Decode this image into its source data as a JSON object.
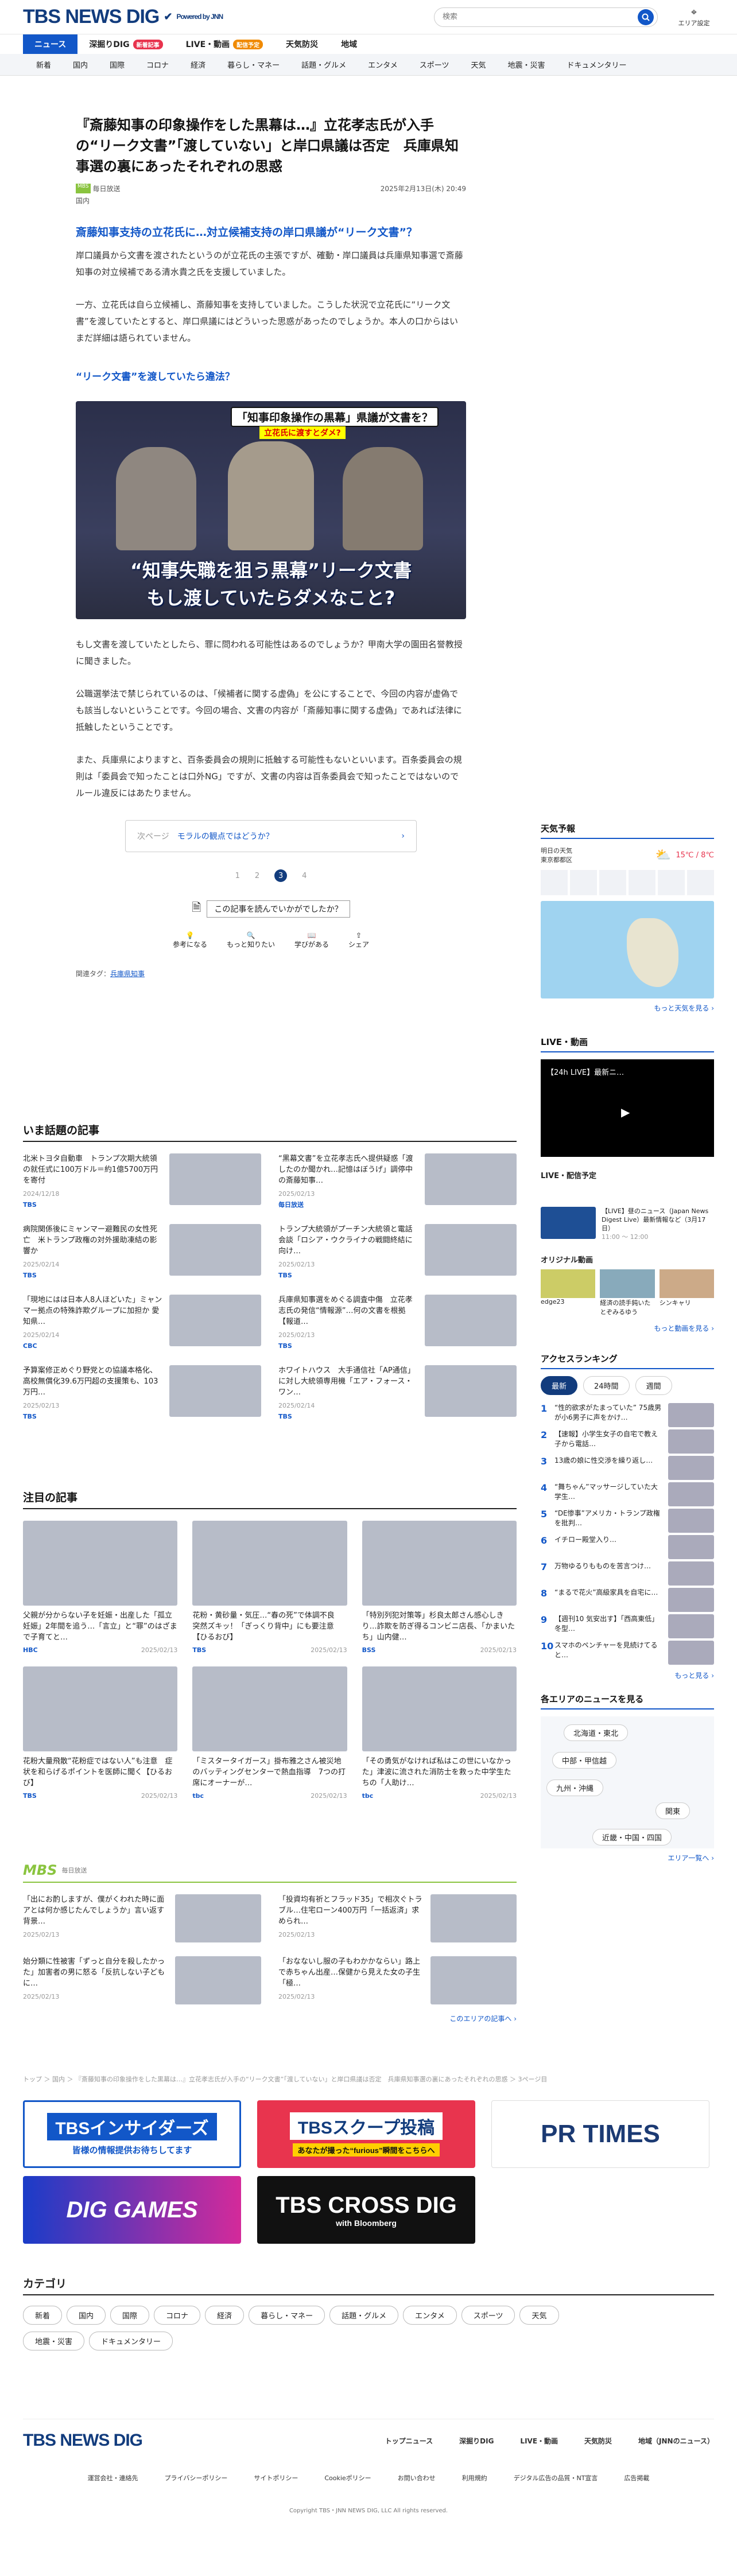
{
  "header": {
    "logo": "TBS NEWS DIG",
    "logo_sub": "Powered by JNN",
    "search_placeholder": "検索",
    "area_label": "エリア設定"
  },
  "gnav": [
    {
      "label": "ニュース",
      "active": true
    },
    {
      "label": "深掘りDIG",
      "badge": "新着記事"
    },
    {
      "label": "LIVE・動画",
      "badge": "配信予定"
    },
    {
      "label": "天気防災"
    },
    {
      "label": "地域"
    }
  ],
  "snav": [
    "新着",
    "国内",
    "国際",
    "コロナ",
    "経済",
    "暮らし・マネー",
    "話題・グルメ",
    "エンタメ",
    "スポーツ",
    "天気",
    "地震・災害",
    "ドキュメンタリー"
  ],
  "article": {
    "title": "『斎藤知事の印象操作をした黒幕は…』立花孝志氏が入手の“リーク文書”「渡していない」と岸口県議は否定　兵庫県知事選の裏にあったそれぞれの思惑",
    "source": "毎日放送",
    "category": "国内",
    "date": "2025年2月13日(木) 20:49",
    "lead": "斎藤知事支持の立花氏に…対立候補支持の岸口県議が“リーク文書”？",
    "p1": "岸口議員から文書を渡されたというのが立花氏の主張ですが、確動・岸口議員は兵庫県知事選で斎藤知事の対立候補である清水貴之氏を支援していました。",
    "p2": "一方、立花氏は自ら立候補し、斎藤知事を支持していました。こうした状況で立花氏に“リーク文書”を渡していたとすると、岸口県議にはどういった思惑があったのでしょうか。本人の口からはいまだ詳細は語られていません。",
    "h2": "リーク文書”を渡していたら違法？",
    "caption_top": "「知事印象操作の黒幕」県議が文書を？",
    "caption_sub": "立花氏に渡すとダメ?",
    "caption_big1": "“知事失職を狙う黒幕”リーク文書",
    "caption_big2": "もし渡していたらダメなこと?",
    "p3": "もし文書を渡していたとしたら、罪に問われる可能性はあるのでしょうか？甲南大学の園田名誉教授に聞きました。",
    "p4": "公職選挙法で禁じられているのは、「候補者に関する虚偽」を公にすることで、今回の内容が虚偽でも該当しないということです。今回の場合、文書の内容が「斎藤知事に関する虚偽」であれば法律に抵触したということです。",
    "p5": "また、兵庫県によりますと、百条委員会の規則に抵触する可能性もないといいます。百条委員会の規則は「委員会で知ったことは口外NG」ですが、文書の内容は百条委員会で知ったことではないのでルール違反にはあたりません。",
    "next_label": "次ページ",
    "next_title": "モラルの観点ではどうか？",
    "pages": [
      "1",
      "2",
      "3",
      "4"
    ],
    "feedback_q": "この記事を読んでいかがでしたか？",
    "reactions": [
      "参考になる",
      "もっと知りたい",
      "学びがある",
      "シェア"
    ],
    "tags_label": "関連タグ：",
    "tag": "兵庫県知事"
  },
  "trending": {
    "title": "いま話題の記事",
    "items": [
      {
        "text": "北米トヨタ自動車　トランプ次期大統領の就任式に100万ドル＝約1億5700万円を寄付",
        "date": "2024/12/18",
        "src": "TBS"
      },
      {
        "text": "“黒幕文書”を立花孝志氏へ提供疑惑「渡したのか聞かれ…記憶はぼうげ」調停中の斎藤知事…",
        "date": "2025/02/13",
        "src": "毎日放送"
      },
      {
        "text": "病院関係後にミャンマー避難民の女性死亡　米トランプ政権の対外援助凍結の影響か",
        "date": "2025/02/14",
        "src": "TBS"
      },
      {
        "text": "トランプ大統領がプーチン大統領と電話会談「ロシア・ウクライナの戦闘終結に向け…",
        "date": "2025/02/13",
        "src": "TBS"
      },
      {
        "text": "「現地にはは日本人8人ほどいた」ミャンマー拠点の特殊詐欺グループに加担か 愛知県…",
        "date": "2025/02/14",
        "src": "CBC"
      },
      {
        "text": "兵庫県知事選をめぐる調査中傷　立花孝志氏の発信“情報源”…何の文書を根拠【報道…",
        "date": "2025/02/13",
        "src": "TBS"
      },
      {
        "text": "予算案修正めぐり野党との協議本格化、高校無償化39.6万円超の支援策も、103万円…",
        "date": "2025/02/13",
        "src": "TBS"
      },
      {
        "text": "ホワイトハウス　大手通信社「AP通信」に対し大統領専用機「エア・フォース・ワン…",
        "date": "2025/02/14",
        "src": "TBS"
      }
    ]
  },
  "featured": {
    "title": "注目の記事",
    "items": [
      {
        "text": "父親が分からない子を妊娠・出産した「孤立妊娠」2年間を追う…「言立」と“罪”のはざまで子育てと…",
        "date": "2025/02/13",
        "src": "HBC"
      },
      {
        "text": "花粉・黄砂量・気圧…“春の死”で体調不良　突然ズキッ！「ぎっくり背中」にも要注意【ひるおび】",
        "date": "2025/02/13",
        "src": "TBS"
      },
      {
        "text": "「特別列犯対策等」杉良太郎さん感心しきり…詐欺を防ぎ得るコンビニ店長、「かまいたち」山内健…",
        "date": "2025/02/13",
        "src": "BSS"
      },
      {
        "text": "花粉大量飛散“花粉症ではない人”も注意　症状を和らげるポイントを医師に聞く【ひるおび】",
        "date": "2025/02/13",
        "src": "TBS"
      },
      {
        "text": "「ミスタータイガース」掛布雅之さん被災地のバッティングセンターで熱血指導　7つの打席にオーナーが…",
        "date": "2025/02/13",
        "src": "tbc"
      },
      {
        "text": "「その勇気がなければ私はこの世にいなかった」津波に流された消防士を救った中学生たちの「人助け…",
        "date": "2025/02/13",
        "src": "tbc"
      }
    ]
  },
  "mbs": {
    "logo": "MBS",
    "label": "毎日放送",
    "items": [
      {
        "text": "「出にお酌しますが、僕がくわれた時に面アとは何か感じたんでしょうか」言い返す背景…",
        "date": "2025/02/13"
      },
      {
        "text": "「投資均有祈とフラッド35」で相次ぐトラブル…住宅ローン400万円「一括返済」求められ…",
        "date": "2025/02/13"
      },
      {
        "text": "始分類に性被害「ずっと自分を殺したかった」加害者の男に怒る「反抗しない子どもに…",
        "date": "2025/02/13"
      },
      {
        "text": "「おなないし服の子もわかかならい」路上で赤ちゃん出産…保健から見えた女の子生「極…",
        "date": "2025/02/13"
      }
    ],
    "more": "このエリアの記事へ"
  },
  "breadcrumb": "トップ ＞ 国内 ＞ 『斎藤知事の印象操作をした黒幕は…』立花孝志氏が入手の“リーク文書”「渡していない」と岸口県議は否定　兵庫県知事選の裏にあったそれぞれの思惑 ＞ 3ページ目",
  "banners": {
    "insider": "TBSインサイダーズ",
    "insider_sub": "皆様の情報提供お待ちしてます",
    "scoop": "TBSスクープ投稿",
    "scoop_sub": "あなたが撮った“furious”瞬間をこちらへ",
    "prtimes": "PR TIMES",
    "dig": "DIG GAMES",
    "cross": "TBS CROSS DIG",
    "cross_sub": "with Bloomberg"
  },
  "categories": {
    "title": "カテゴリ",
    "items": [
      "新着",
      "国内",
      "国際",
      "コロナ",
      "経済",
      "暮らし・マネー",
      "話題・グルメ",
      "エンタメ",
      "スポーツ",
      "天気",
      "地震・災害",
      "ドキュメンタリー"
    ]
  },
  "sidebar": {
    "weather_title": "天気予報",
    "weather_loc": "明日の天気\n東京都都区",
    "weather_temp": "15℃ / 8℃",
    "weather_more": "もっと天気を見る",
    "live_title": "LIVE・動画",
    "live_video": "【24h LIVE】最新ニ…",
    "live_sched": "LIVE・配信予定",
    "live_item1": "【LIVE】昼のニュース（Japan News Digest Live）最新情報など（3月17日）",
    "live_item1_meta": "11:00 〜 12:00",
    "orig_title": "オリジナル動画",
    "orig": [
      "edge23",
      "経済の読手鈍いたとぞみるゆう",
      "シンキャリ"
    ],
    "video_more": "もっと動画を見る",
    "rank_title": "アクセスランキング",
    "rank_tabs": [
      "最新",
      "24時間",
      "週間"
    ],
    "rank": [
      "“性的欲求がたまっていた” 75歳男が小6男子に声をかけ…",
      "【速報】小学生女子の自宅で教え子から電話…",
      "13歳の娘に性交渉を繰り返し…",
      "“舞ちゃん”マッサージしていた大学生…",
      "“DE惨事”アメリカ・トランプ政権を批判…",
      "イチロー殿堂入り…",
      "万物ゆるりもものを苦言つけ…",
      "“まるで花火”高級家具を自宅に…",
      "【週刊10 気安出す】「西高東低」冬型…",
      "スマホのペンチャーを見続けてると…"
    ],
    "rank_more": "もっと見る",
    "area_title": "各エリアのニュースを見る",
    "areas": [
      "北海道・東北",
      "中部・甲信越",
      "九州・沖縄",
      "関東",
      "近畿・中国・四国"
    ],
    "area_more": "エリア一覧へ"
  },
  "footer": {
    "logo": "TBS NEWS DIG",
    "nav": [
      "トップニュース",
      "深掘りDIG",
      "LIVE・動画",
      "天気防災",
      "地域（JNNのニュース）"
    ],
    "links": [
      "運営会社・連絡先",
      "プライバシーポリシー",
      "サイトポリシー",
      "Cookieポリシー",
      "お問い合わせ",
      "利用規約",
      "デジタル広告の品質・NT宣言",
      "広告掲載"
    ],
    "copy": "Copyright TBS・JNN NEWS DIG, LLC All rights reserved."
  },
  "colors": {
    "accent": "#1257c8",
    "navy": "#123c7d"
  }
}
